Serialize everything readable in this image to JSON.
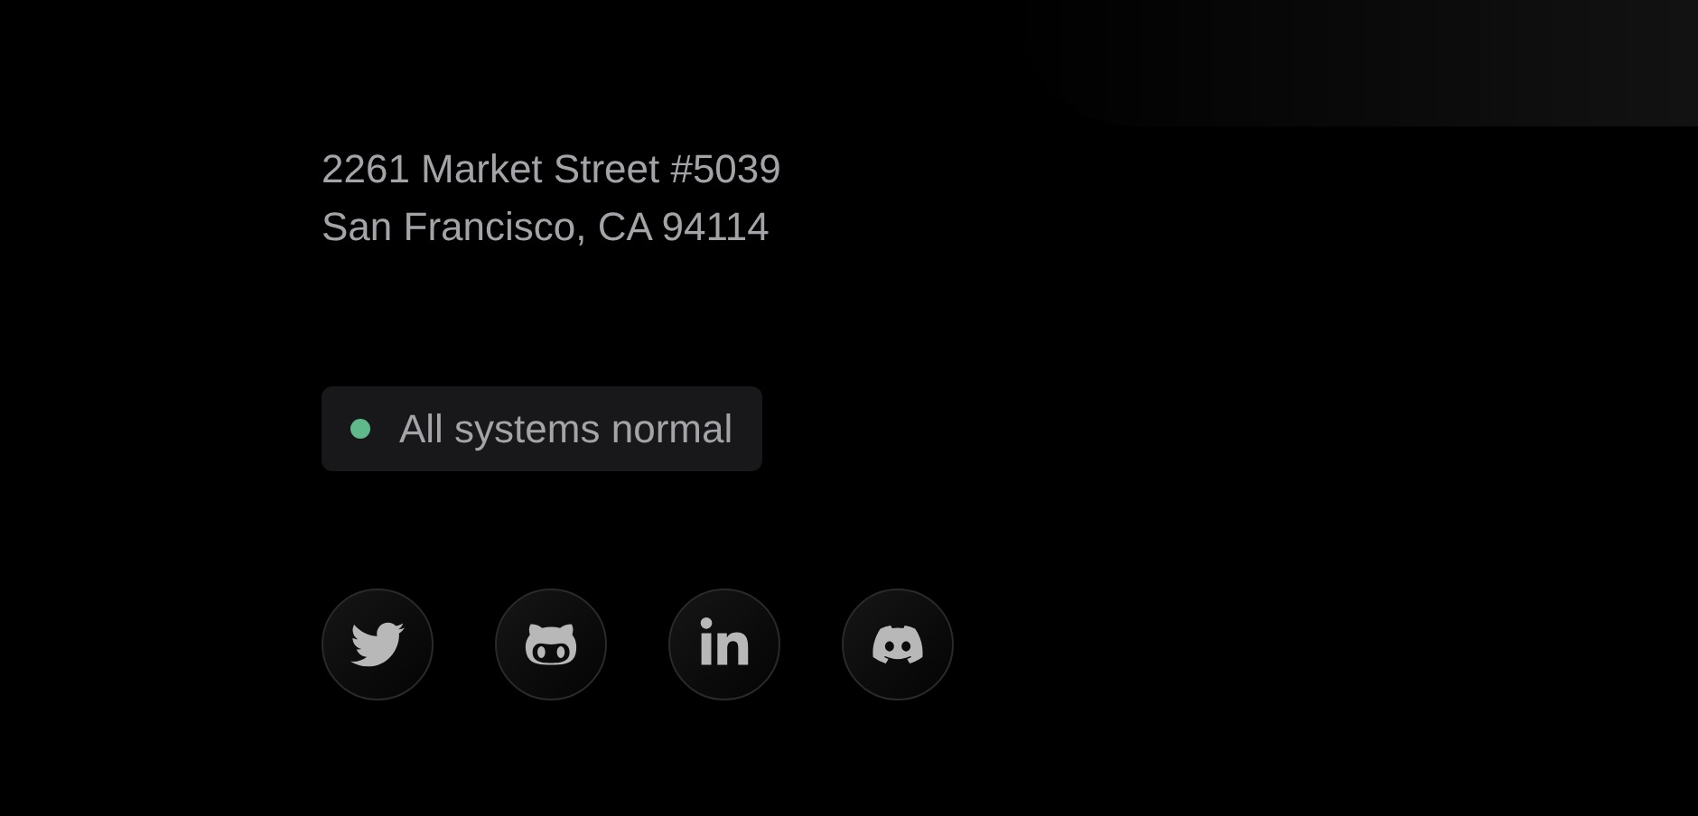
{
  "address": {
    "lines": [
      "2261 Market Street #5039",
      "San Francisco, CA 94114"
    ]
  },
  "status": {
    "text": "All systems normal",
    "color": "#5fb98a"
  },
  "social_links": [
    {
      "kind": "twitter"
    },
    {
      "kind": "github"
    },
    {
      "kind": "linkedin"
    },
    {
      "kind": "discord"
    }
  ]
}
